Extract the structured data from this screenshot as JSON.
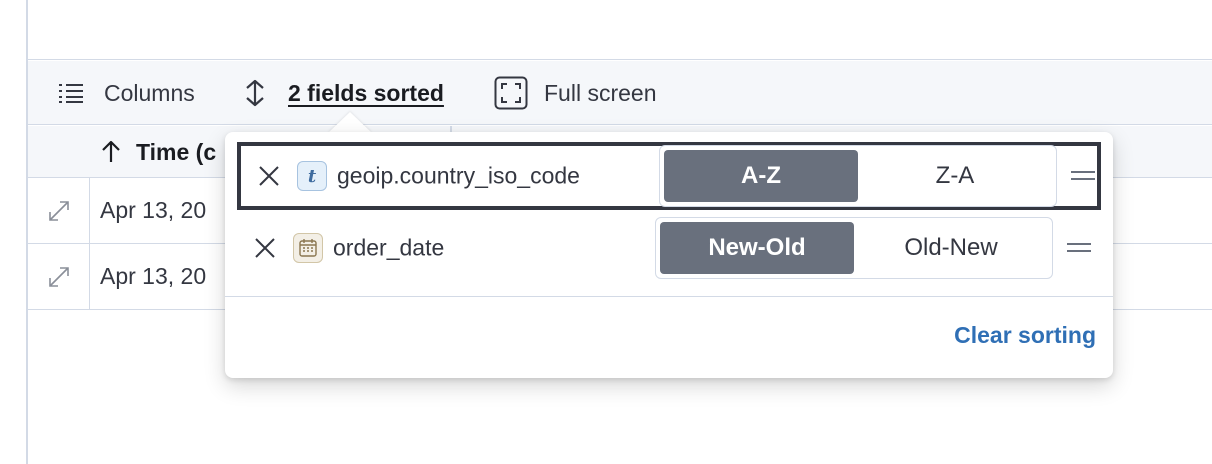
{
  "toolbar": {
    "columns_label": "Columns",
    "sort_label": "2 fields sorted",
    "fullscreen_label": "Full screen"
  },
  "grid": {
    "header": {
      "time_label": "Time (c"
    },
    "rows": [
      {
        "time": "Apr 13, 20"
      },
      {
        "time": "Apr 13, 20"
      }
    ]
  },
  "sort_popover": {
    "fields": [
      {
        "name": "geoip.country_iso_code",
        "type_icon": "text-type-icon",
        "type_glyph": "t",
        "options": [
          "A-Z",
          "Z-A"
        ],
        "selected": "A-Z"
      },
      {
        "name": "order_date",
        "type_icon": "date-type-icon",
        "options": [
          "New-Old",
          "Old-New"
        ],
        "selected": "New-Old"
      }
    ],
    "clear_label": "Clear sorting"
  },
  "colors": {
    "accent_link": "#2f6fb5",
    "active_toggle": "#69707d",
    "toolbar_bg": "#f5f7fa",
    "border": "#d3dae6"
  }
}
